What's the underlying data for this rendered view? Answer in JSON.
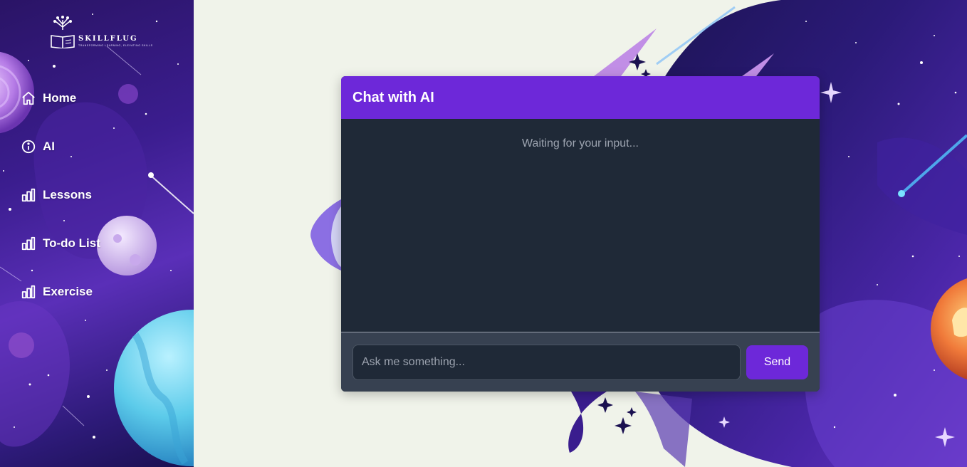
{
  "brand": {
    "name": "SKILLFLUG",
    "tagline": "TRANSFORMING LEARNING, ELEVATING SKILLS"
  },
  "sidebar": {
    "items": [
      {
        "label": "Home",
        "icon": "home-icon"
      },
      {
        "label": "AI",
        "icon": "info-icon"
      },
      {
        "label": "Lessons",
        "icon": "bar-chart-icon"
      },
      {
        "label": "To-do List",
        "icon": "bar-chart-icon"
      },
      {
        "label": "Exercise",
        "icon": "bar-chart-icon"
      }
    ]
  },
  "chat": {
    "title": "Chat with AI",
    "status": "Waiting for your input...",
    "input_placeholder": "Ask me something...",
    "input_value": "",
    "send_label": "Send"
  },
  "colors": {
    "accent": "#6d28d9",
    "panel": "#1f2937",
    "footer": "#374151",
    "page_bg": "#f0f3ea"
  }
}
